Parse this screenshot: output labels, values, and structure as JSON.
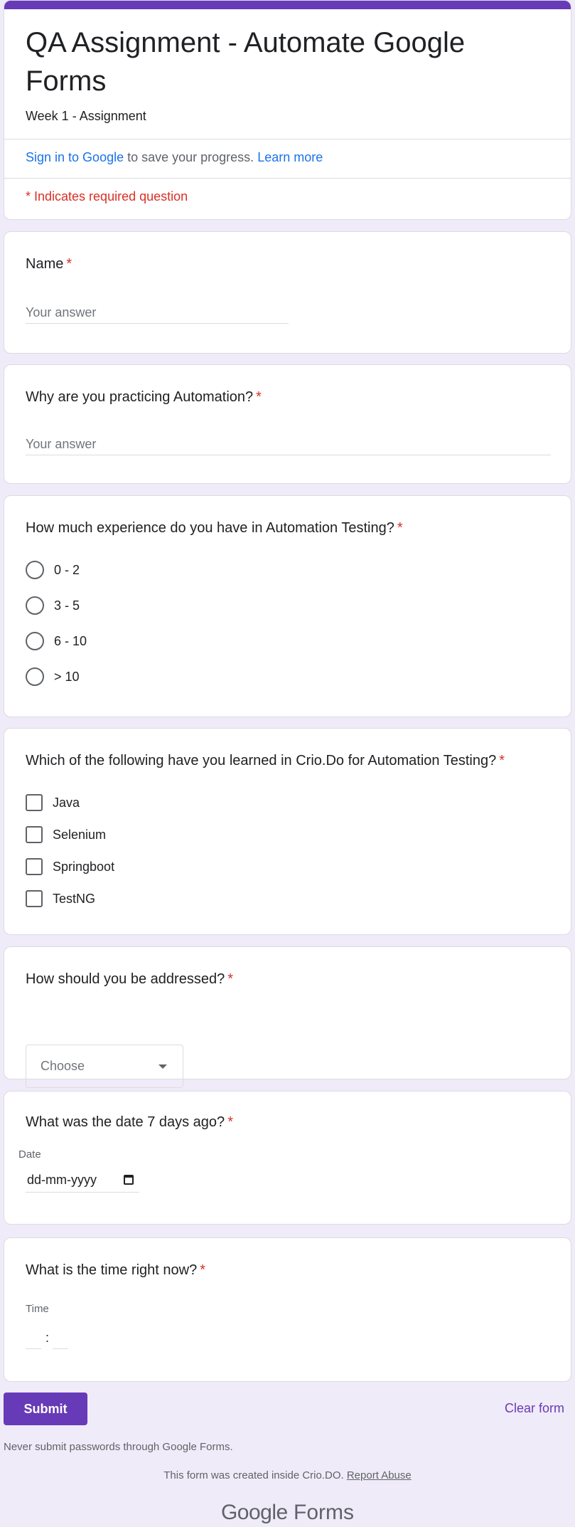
{
  "header": {
    "title": "QA Assignment - Automate Google Forms",
    "description": "Week 1 - Assignment",
    "signin_link": "Sign in to Google",
    "signin_text": " to save your progress. ",
    "learn_more": "Learn more",
    "required_note": "* Indicates required question"
  },
  "questions": {
    "name": {
      "title": "Name",
      "required_mark": "*",
      "placeholder": "Your answer"
    },
    "why": {
      "title": "Why are you practicing Automation?",
      "required_mark": "*",
      "placeholder": "Your answer"
    },
    "experience": {
      "title": "How much experience do you have in Automation Testing?",
      "required_mark": "*",
      "options": [
        "0 - 2",
        "3 - 5",
        "6 - 10",
        "> 10"
      ]
    },
    "learned": {
      "title": "Which of the following have you learned in Crio.Do for Automation Testing?",
      "required_mark": "*",
      "options": [
        "Java",
        "Selenium",
        "Springboot",
        "TestNG"
      ]
    },
    "address": {
      "title": "How should you be addressed?",
      "required_mark": "*",
      "select_value": "Choose"
    },
    "date": {
      "title": "What was the date 7 days ago?",
      "required_mark": "*",
      "label": "Date",
      "value": "dd-mm-yyyy"
    },
    "time": {
      "title": "What is the time right now?",
      "required_mark": "*",
      "label": "Time",
      "separator": ":"
    }
  },
  "actions": {
    "submit": "Submit",
    "clear": "Clear form"
  },
  "footer": {
    "warning": "Never submit passwords through Google Forms.",
    "created": "This form was created inside Crio.DO.",
    "report": "Report Abuse",
    "brand_google": "Google",
    "brand_forms": "Forms"
  },
  "colors": {
    "accent": "#673ab7",
    "background": "#f0ebf8",
    "required": "#d93025",
    "link": "#1a73e8"
  },
  "icons": {
    "select": "chevron-down-icon",
    "date": "calendar-icon"
  }
}
